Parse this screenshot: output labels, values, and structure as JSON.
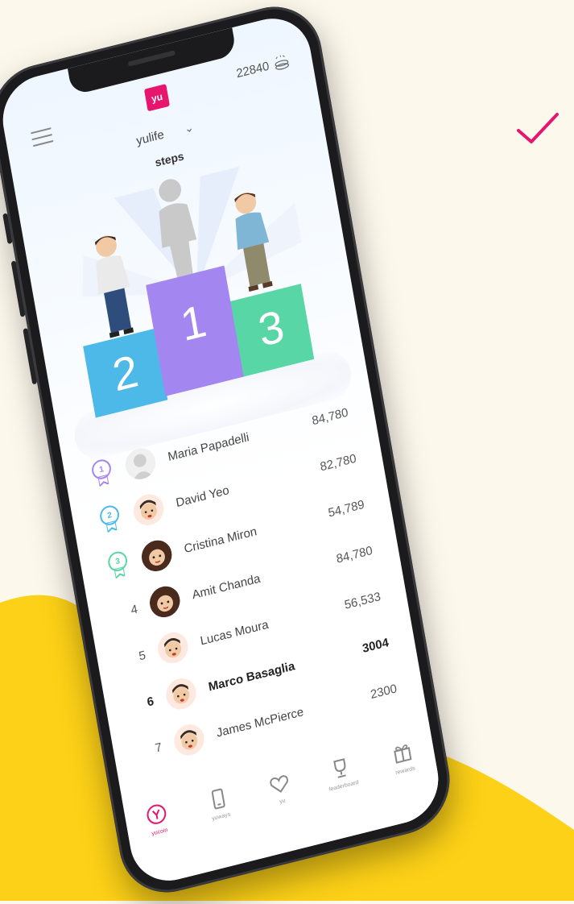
{
  "app": {
    "logo_text": "yu",
    "coins": "22840",
    "group_name": "yulife",
    "metric": "steps",
    "brand_color": "#e8156f"
  },
  "podium": {
    "first": "1",
    "second": "2",
    "third": "3",
    "colors": {
      "first": "#a486f0",
      "second": "#4cb9e8",
      "third": "#58d6a5"
    }
  },
  "leaderboard": [
    {
      "rank": "1",
      "badge": true,
      "badge_color": "#a486f0",
      "name": "Maria Papadelli",
      "score": "84,780",
      "avatar": "placeholder"
    },
    {
      "rank": "2",
      "badge": true,
      "badge_color": "#4cb9e8",
      "name": "David Yeo",
      "score": "82,780",
      "avatar": "man"
    },
    {
      "rank": "3",
      "badge": true,
      "badge_color": "#58d6a5",
      "name": "Cristina Miron",
      "score": "54,789",
      "avatar": "woman"
    },
    {
      "rank": "4",
      "badge": false,
      "name": "Amit Chanda",
      "score": "84,780",
      "avatar": "woman"
    },
    {
      "rank": "5",
      "badge": false,
      "name": "Lucas Moura",
      "score": "56,533",
      "avatar": "man"
    },
    {
      "rank": "6",
      "badge": false,
      "name": "Marco Basaglia",
      "score": "3004",
      "avatar": "man",
      "me": true
    },
    {
      "rank": "7",
      "badge": false,
      "name": "James McPierce",
      "score": "2300",
      "avatar": "man"
    }
  ],
  "tabs": [
    {
      "label": "yucoin",
      "icon": "yucoin-icon",
      "active": true
    },
    {
      "label": "yuways",
      "icon": "phone-icon",
      "active": false
    },
    {
      "label": "yu",
      "icon": "heart-icon",
      "active": false
    },
    {
      "label": "leaderboard",
      "icon": "trophy-icon",
      "active": false
    },
    {
      "label": "rewards",
      "icon": "gift-icon",
      "active": false
    }
  ]
}
